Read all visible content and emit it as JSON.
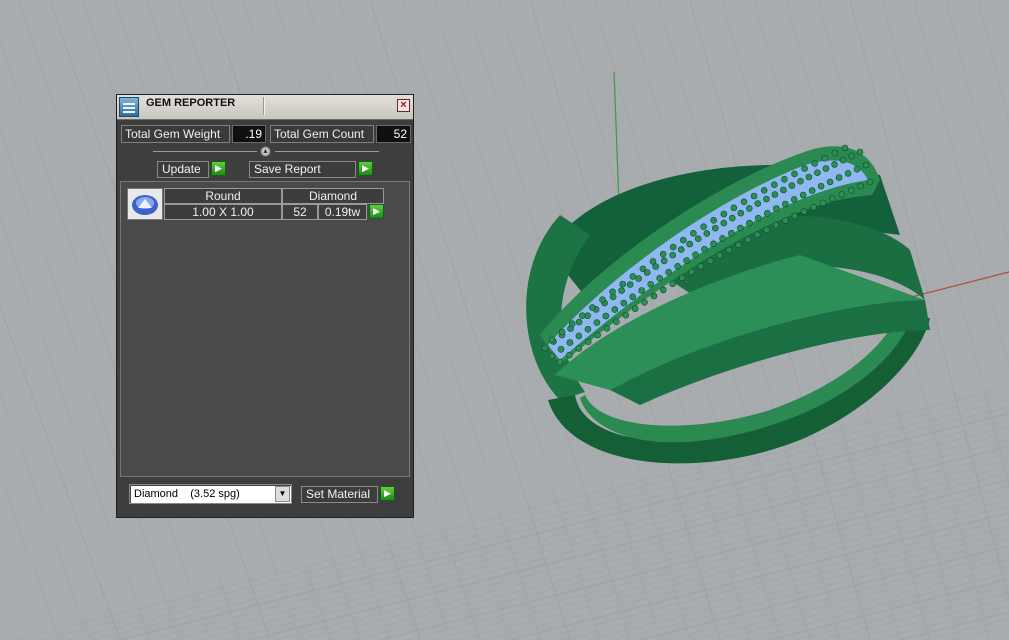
{
  "panel": {
    "title": "GEM REPORTER",
    "close_glyph": "×",
    "icon": "gem-reporter-app-icon",
    "total_weight_label": "Total Gem Weight",
    "total_weight_value": ".19",
    "total_count_label": "Total Gem Count",
    "total_count_value": "52",
    "update_label": "Update",
    "save_report_label": "Save Report",
    "arrow_glyph": "▶",
    "gem_rows": [
      {
        "shape": "Round",
        "material": "Diamond",
        "size": "1.00 X 1.00",
        "count": "52",
        "weight": "0.19tw",
        "thumbnail": "round-gem-icon"
      }
    ],
    "material_select_value": "Diamond    (3.52 spg)",
    "select_arrow_glyph": "▼",
    "set_material_label": "Set Material"
  },
  "viewport": {
    "background": "#a9acaf",
    "grid_color": "#9ea1a4",
    "x_axis_color": "#b24a3f",
    "y_axis_color": "#3f9a3f",
    "ring_color": "#1f7a45",
    "pave_color": "#8fb8f0",
    "gem_bead_color": "#2a8f55"
  }
}
